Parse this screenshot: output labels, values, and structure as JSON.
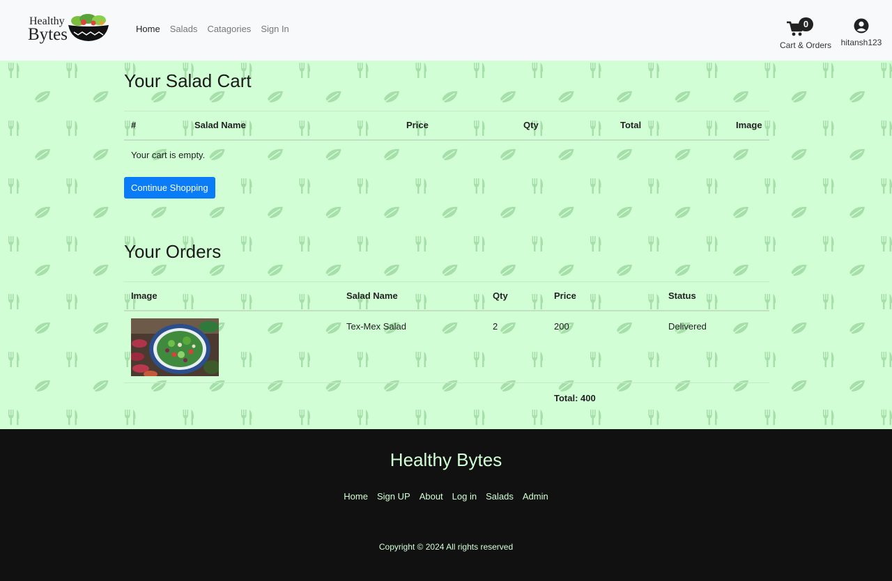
{
  "brand": {
    "line1": "Healthy",
    "line2": "Bytes"
  },
  "nav": {
    "links": [
      "Home",
      "Salads",
      "Catagories",
      "Sign In"
    ]
  },
  "cart": {
    "count": "0",
    "label": "Cart & Orders"
  },
  "user": {
    "name": "hitansh123"
  },
  "cart_section": {
    "title": "Your Salad Cart",
    "headers": [
      "#",
      "Salad Name",
      "Price",
      "Qty",
      "Total",
      "Image"
    ],
    "empty_message": "Your cart is empty.",
    "continue_button": "Continue Shopping"
  },
  "orders_section": {
    "title": "Your Orders",
    "headers": [
      "Image",
      "Salad Name",
      "Qty",
      "Price",
      "Status"
    ],
    "rows": [
      {
        "name": "Tex-Mex Salad",
        "qty": "2",
        "price": "200",
        "status": "Delivered"
      }
    ],
    "total": "Total: 400"
  },
  "footer": {
    "title": "Healthy Bytes",
    "links": [
      "Home",
      "Sign UP",
      "About",
      "Log in",
      "Salads",
      "Admin"
    ],
    "copyright": "Copyright © 2024 All rights reserved"
  },
  "colors": {
    "background": "#d2fed6",
    "pattern": "#a7dfaa",
    "primary_button": "#0a7cf8",
    "footer_bg": "#111111",
    "footer_text": "#d2fed6"
  }
}
